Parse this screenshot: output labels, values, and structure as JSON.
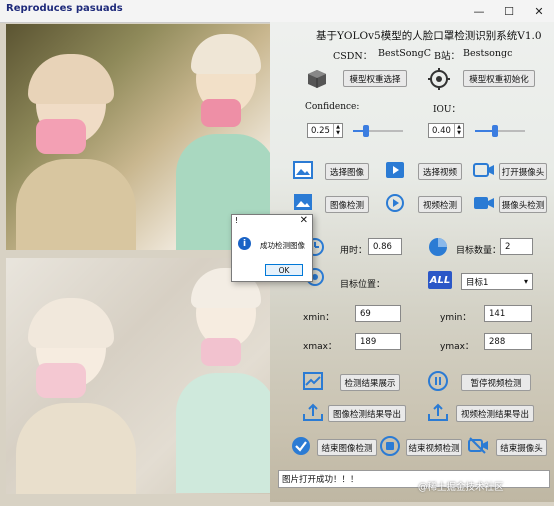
{
  "window": {
    "title": "Reproduces pasuads",
    "controls": [
      "—",
      "☐",
      "✕"
    ]
  },
  "header": {
    "title": "基于YOLOv5模型的人脸口罩检测识别系统V1.0",
    "csdn_label": "CSDN：",
    "csdn_value": "BestSongC",
    "bilibili_label": "B站：",
    "bilibili_value": "Bestsongc"
  },
  "model": {
    "select_weights_label": "模型权重选择",
    "init_weights_label": "模型权重初始化"
  },
  "params": {
    "confidence_label": "Confidence:",
    "confidence_value": "0.25",
    "confidence_level": 0.25,
    "iou_label": "IOU：",
    "iou_value": "0.40",
    "iou_level": 0.4
  },
  "actions": {
    "select_image": "选择图像",
    "select_video": "选择视频",
    "open_camera": "打开摄像头",
    "image_detect": "图像检测",
    "video_detect": "视频检测",
    "camera_detect": "摄像头检测"
  },
  "results": {
    "time_label": "用时：",
    "time_value": "0.86",
    "count_label": "目标数量：",
    "count_value": "2",
    "position_label": "目标位置：",
    "target_select_value": "目标1",
    "all_badge": "ALL",
    "xmin_label": "xmin：",
    "xmin_value": "69",
    "ymin_label": "ymin：",
    "ymin_value": "141",
    "xmax_label": "xmax：",
    "xmax_value": "189",
    "ymax_label": "ymax：",
    "ymax_value": "288"
  },
  "bottom_actions": {
    "show_results": "检测结果展示",
    "pause_video": "暂停视频检测",
    "export_image_results": "图像检测结果导出",
    "export_video_results": "视频检测结果导出",
    "end_image_detect": "结束图像检测",
    "end_video_detect": "结束视频检测",
    "end_camera": "结束摄像头"
  },
  "status": {
    "message": "图片打开成功！！！"
  },
  "watermark": "@稀土掘金技术社区",
  "dialog": {
    "title": "!",
    "message": "成功检测图像",
    "ok_label": "OK"
  },
  "icons": {
    "cube": "cube-icon",
    "target": "crosshair-icon",
    "image": "image-icon",
    "video": "video-play-icon",
    "camera": "camera-icon",
    "chart": "chart-icon",
    "pause": "pause-icon",
    "upload": "upload-icon",
    "check": "check-icon",
    "stop": "stop-icon",
    "video_off": "video-off-icon",
    "info": "info-icon"
  },
  "colors": {
    "accent": "#1a63c5",
    "slider": "#3b7de0"
  }
}
